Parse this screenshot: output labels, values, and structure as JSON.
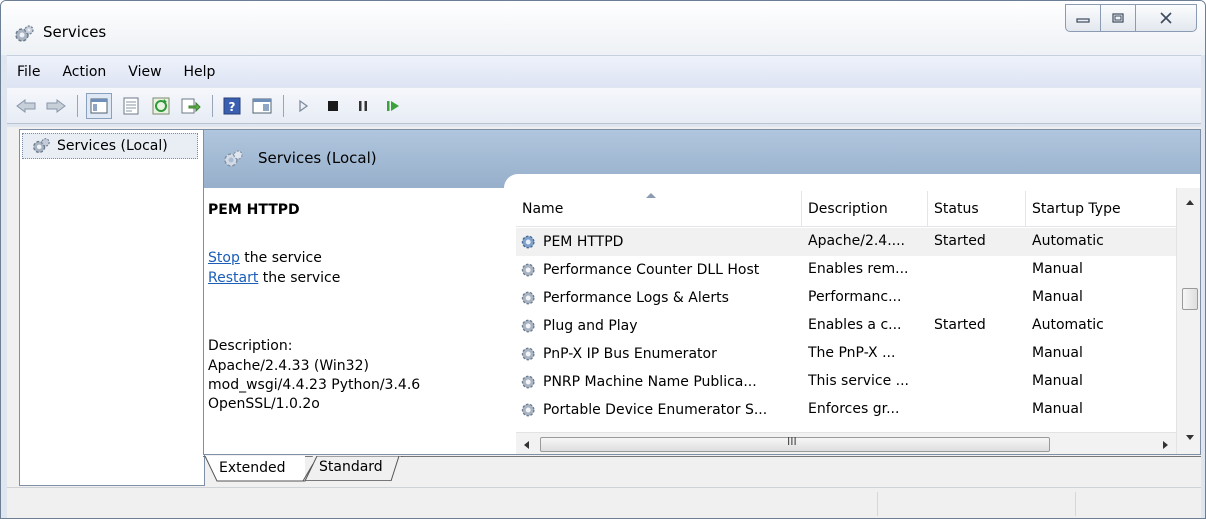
{
  "window": {
    "title": "Services",
    "icon": "services-gear-icon",
    "controls": [
      "minimize-icon",
      "restore-icon",
      "close-icon"
    ]
  },
  "menubar": {
    "items": [
      "File",
      "Action",
      "View",
      "Help"
    ]
  },
  "toolbar": {
    "icons": [
      "back-arrow-icon",
      "forward-arrow-icon",
      "show-hide-tree-icon",
      "properties-icon",
      "refresh-icon",
      "export-list-icon",
      "help-icon",
      "view-icon",
      "start-service-icon",
      "stop-service-icon",
      "pause-service-icon",
      "resume-service-icon"
    ]
  },
  "tree": {
    "root_label": "Services (Local)"
  },
  "main": {
    "header_title": "Services (Local)"
  },
  "detail": {
    "service_name": "PEM HTTPD",
    "stop_link": "Stop",
    "stop_suffix": " the service",
    "restart_link": "Restart",
    "restart_suffix": " the service",
    "description_label": "Description:",
    "description_lines": [
      "Apache/2.4.33 (Win32)",
      "mod_wsgi/4.4.23 Python/3.4.6",
      "OpenSSL/1.0.2o"
    ]
  },
  "list": {
    "columns": [
      "Name",
      "Description",
      "Status",
      "Startup Type"
    ],
    "sorted_column": "Name",
    "rows": [
      {
        "name": "PEM HTTPD",
        "description": "Apache/2.4....",
        "status": "Started",
        "startup": "Automatic",
        "selected": true
      },
      {
        "name": "Performance Counter DLL Host",
        "description": "Enables rem...",
        "status": "",
        "startup": "Manual"
      },
      {
        "name": "Performance Logs & Alerts",
        "description": "Performanc...",
        "status": "",
        "startup": "Manual"
      },
      {
        "name": "Plug and Play",
        "description": "Enables a c...",
        "status": "Started",
        "startup": "Automatic"
      },
      {
        "name": "PnP-X IP Bus Enumerator",
        "description": "The PnP-X ...",
        "status": "",
        "startup": "Manual"
      },
      {
        "name": "PNRP Machine Name Publica...",
        "description": "This service ...",
        "status": "",
        "startup": "Manual"
      },
      {
        "name": "Portable Device Enumerator S...",
        "description": "Enforces gr...",
        "status": "",
        "startup": "Manual"
      }
    ],
    "hscroll_grip": "III"
  },
  "tabs": {
    "extended": "Extended",
    "standard": "Standard",
    "active": "Extended"
  }
}
